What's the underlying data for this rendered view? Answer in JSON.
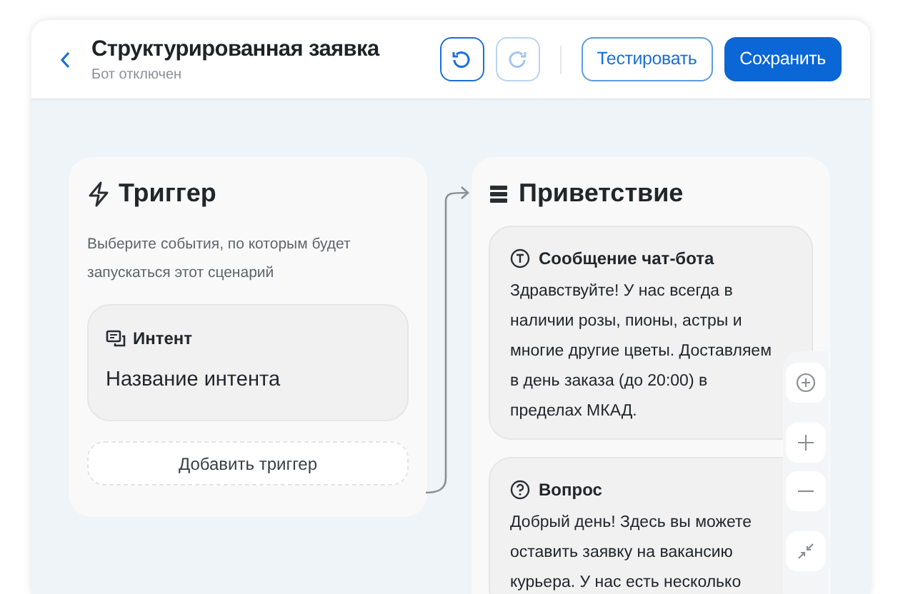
{
  "header": {
    "title": "Структурированная заявка",
    "subtitle": "Бот отключен",
    "undo": {
      "disabled": false
    },
    "redo": {
      "disabled": true
    },
    "test_button": "Тестировать",
    "save_button": "Сохранить"
  },
  "trigger_node": {
    "title": "Триггер",
    "description": "Выберите события, по которым будет запускаться этот сценарий",
    "intent": {
      "label": "Интент",
      "value": "Название интента"
    },
    "add_button": "Добавить триггер"
  },
  "greeting_node": {
    "title": "Приветствие",
    "blocks": [
      {
        "kind": "message",
        "label": "Сообщение чат-бота",
        "text": "Здравствуйте! У нас всегда в наличии розы, пионы, астры и многие другие цветы. Доставляем в день заказа (до 20:00) в пределах МКАД."
      },
      {
        "kind": "question",
        "label": "Вопрос",
        "text": "Добрый день! Здесь вы можете оставить заявку на вакансию курьера. У нас есть несколько"
      }
    ]
  }
}
